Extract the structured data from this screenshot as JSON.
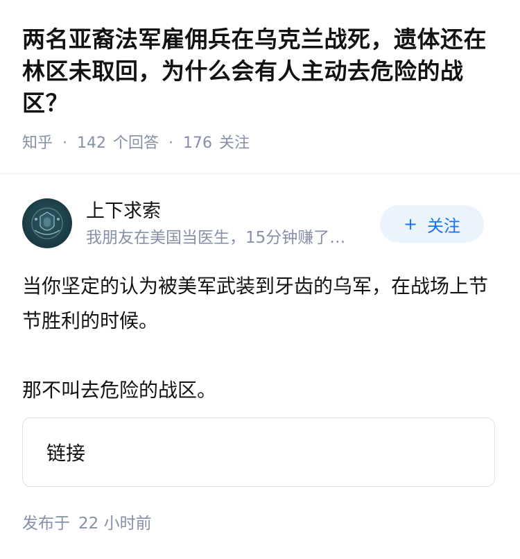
{
  "question": {
    "title": "两名亚裔法军雇佣兵在乌克兰战死，遗体还在林区未取回，为什么会有人主动去危险的战区？",
    "source": "知乎",
    "answer_count": "142",
    "answer_label": "个回答",
    "follower_count": "176",
    "follower_label": "关注",
    "separator": "·"
  },
  "author": {
    "name": "上下求索",
    "bio": "我朋友在美国当医生，15分钟赚了…",
    "follow_plus": "+",
    "follow_label": "关注"
  },
  "answer": {
    "paragraphs": [
      "当你坚定的认为被美军武装到牙齿的乌军，在战场上节节胜利的时候。",
      "那不叫去危险的战区。"
    ],
    "link_card_label": "链接",
    "published_label": "发布于",
    "published_value": "22 小时前"
  },
  "colors": {
    "accent": "#1772f6",
    "accent_bg": "#ebf3fd",
    "meta_text": "#8590a6",
    "avatar_bg": "#1d3f48"
  }
}
